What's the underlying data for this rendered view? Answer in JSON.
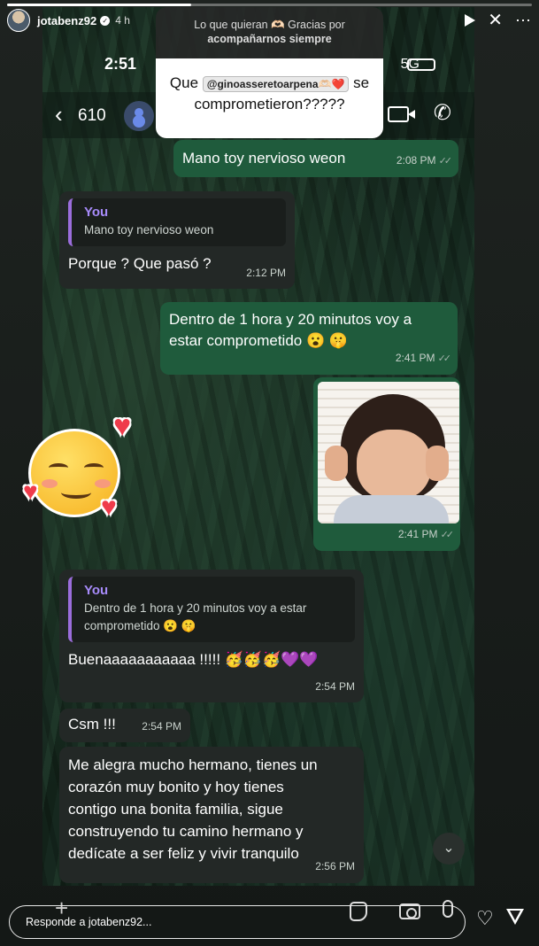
{
  "instagram": {
    "username": "jotabenz92",
    "time_ago": "4 h",
    "story_progress": 0.35,
    "reply_placeholder": "Responde a jotabenz92..."
  },
  "question_sticker": {
    "prompt_line1": "Lo que quieran 🫶🏻 Gracias por",
    "prompt_line2": "acompañarnos siempre",
    "mention": "@ginoasseretoarpena🫶🏻❤️",
    "question_start": "Que",
    "question_mid": "se",
    "question_end": "comprometieron?????"
  },
  "phone": {
    "status_time": "2:51",
    "network": "5G",
    "unread_count": "610"
  },
  "messages": [
    {
      "text": "Mano toy nervioso weon",
      "time": "2:08 PM",
      "ticks": "✓✓"
    },
    {
      "reply_author": "You",
      "reply_text": "Mano toy nervioso weon",
      "text": "Porque ? Que pasó ?",
      "time": "2:12 PM"
    },
    {
      "text_line1": "Dentro de 1 hora y 20 minutos voy a",
      "text_line2": "estar comprometido 😮 🤫",
      "time": "2:41 PM",
      "ticks": "✓✓"
    },
    {
      "time": "2:41 PM",
      "ticks": "✓✓"
    },
    {
      "reply_author": "You",
      "reply_text_line1": "Dentro de 1 hora y 20 minutos voy a estar",
      "reply_text_line2": "comprometido 😮 🤫",
      "text": "Buenaaaaaaaaaaa !!!!! 🥳🥳🥳💜💜",
      "time": "2:54 PM"
    },
    {
      "text": "Csm !!!",
      "time": "2:54 PM"
    },
    {
      "line1": "Me alegra mucho hermano, tienes un",
      "line2": "corazón muy bonito y hoy tienes",
      "line3": "contigo una bonita familia, sigue",
      "line4": "construyendo tu camino hermano y",
      "line5": "dedícate a ser feliz y vivir tranquilo",
      "time": "2:56 PM"
    }
  ],
  "colors": {
    "outgoing_bubble": "#1f5b3c",
    "incoming_bubble": "#232826",
    "reply_accent": "#9b6ddb",
    "reply_author": "#a78bfa"
  }
}
